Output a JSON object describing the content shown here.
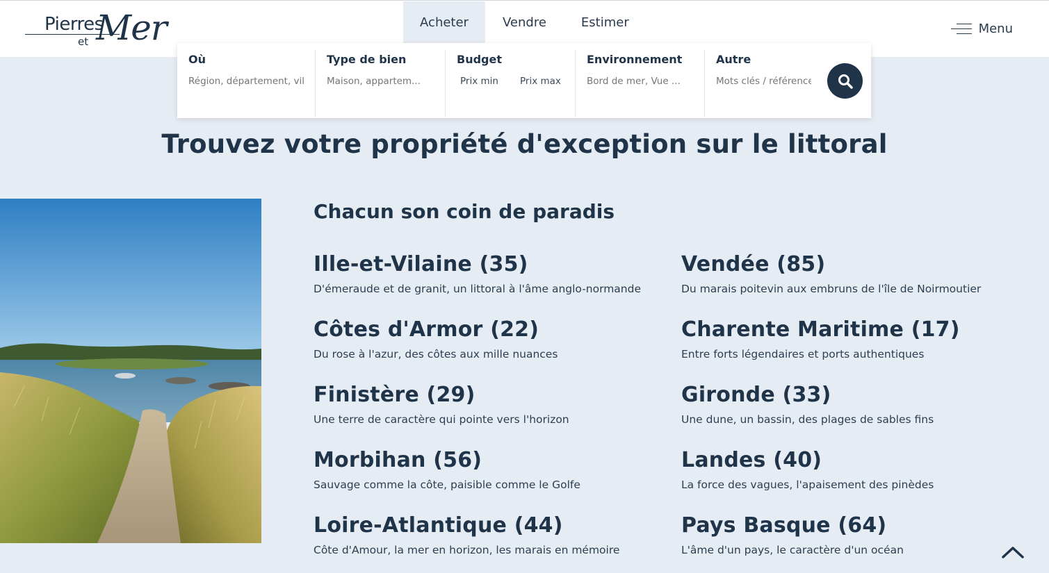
{
  "header": {
    "logo": {
      "word1": "Pierres",
      "word2": "et",
      "word3": "Mer"
    },
    "nav": [
      {
        "label": "Acheter"
      },
      {
        "label": "Vendre"
      },
      {
        "label": "Estimer"
      }
    ],
    "menu_label": "Menu"
  },
  "search": {
    "where": {
      "title": "Où",
      "placeholder": "Région, département, ville"
    },
    "type": {
      "title": "Type de bien",
      "placeholder": "Maison, appartem..."
    },
    "budget": {
      "title": "Budget",
      "min": "Prix min",
      "max": "Prix max"
    },
    "environment": {
      "title": "Environnement",
      "placeholder": "Bord de mer, Vue ..."
    },
    "other": {
      "title": "Autre",
      "placeholder": "Mots clés / référence"
    },
    "search_icon": "magnifier-icon"
  },
  "tagline": "Trouvez votre propriété d'exception sur le littoral",
  "regions_section": {
    "title": "Chacun son coin de paradis",
    "left": [
      {
        "name": "Ille-et-Vilaine (35)",
        "desc": "D'émeraude et de granit, un littoral à l'âme anglo-normande"
      },
      {
        "name": "Côtes d'Armor (22)",
        "desc": "Du rose à l'azur, des côtes aux mille nuances"
      },
      {
        "name": "Finistère (29)",
        "desc": "Une terre de caractère qui pointe vers l'horizon"
      },
      {
        "name": "Morbihan (56)",
        "desc": "Sauvage comme la côte, paisible comme le Golfe"
      },
      {
        "name": "Loire-Atlantique (44)",
        "desc": "Côte d'Amour, la mer en horizon, les marais en mémoire"
      }
    ],
    "right": [
      {
        "name": "Vendée (85)",
        "desc": "Du marais poitevin aux embruns de l'île de Noirmoutier"
      },
      {
        "name": "Charente Maritime (17)",
        "desc": "Entre forts légendaires et ports authentiques"
      },
      {
        "name": "Gironde (33)",
        "desc": "Une dune, un bassin, des plages de sables fins"
      },
      {
        "name": "Landes (40)",
        "desc": "La force des vagues, l'apaisement des pinèdes"
      },
      {
        "name": "Pays Basque (64)",
        "desc": "L'âme d'un pays, le caractère d'un océan"
      }
    ]
  },
  "colors": {
    "navy": "#1f3349",
    "background": "#e6ecf3"
  },
  "icons": {
    "menu": "hamburger-icon",
    "scroll_top": "chevron-up-icon"
  }
}
